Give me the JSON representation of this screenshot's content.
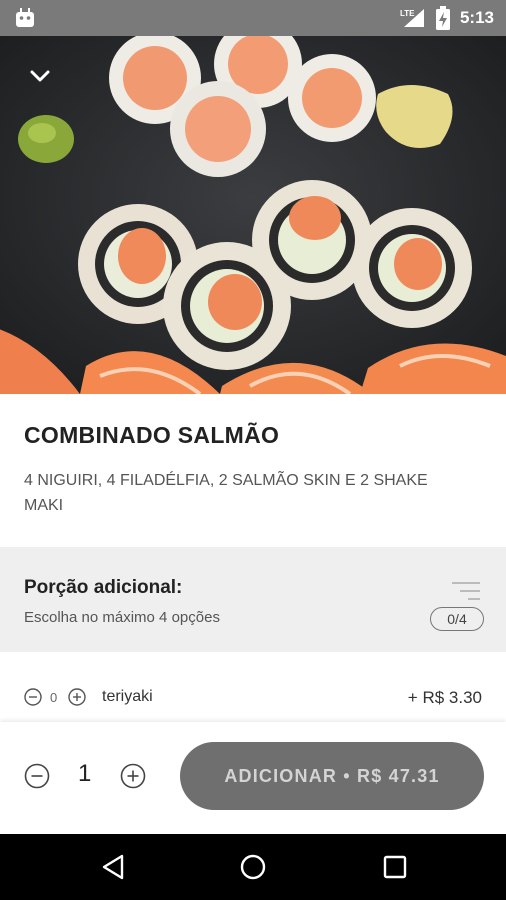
{
  "status_bar": {
    "time": "5:13",
    "network": "LTE"
  },
  "product": {
    "name": "COMBINADO SALMÃO",
    "description": "4 NIGUIRI, 4 FILADÉLFIA, 2 SALMÃO SKIN E 2 SHAKE MAKI"
  },
  "additional": {
    "title": "Porção adicional:",
    "subtitle": "Escolha no máximo 4 opções",
    "badge": "0/4"
  },
  "options": [
    {
      "count": "0",
      "name": "teriyaki",
      "price": "+ R$ 3.30"
    }
  ],
  "cart": {
    "quantity": "1",
    "add_label": "ADICIONAR • R$ 47.31"
  }
}
